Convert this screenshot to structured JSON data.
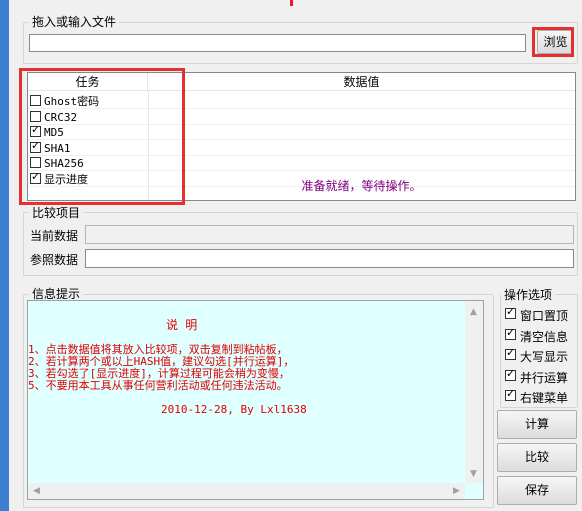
{
  "file_group": {
    "title": "拖入或输入文件",
    "input_value": "",
    "browse_label": "浏览"
  },
  "table": {
    "col_task": "任务",
    "col_value": "数据值",
    "tasks": [
      {
        "label": "Ghost密码",
        "checked": false
      },
      {
        "label": "CRC32",
        "checked": false
      },
      {
        "label": "MD5",
        "checked": true
      },
      {
        "label": "SHA1",
        "checked": true
      },
      {
        "label": "SHA256",
        "checked": false
      },
      {
        "label": "显示进度",
        "checked": true
      }
    ],
    "status": "准备就绪，等待操作。"
  },
  "compare": {
    "title": "比较项目",
    "current_label": "当前数据",
    "current_value": "",
    "reference_label": "参照数据",
    "reference_value": ""
  },
  "info": {
    "title": "信息提示",
    "heading": "说 明",
    "lines": [
      "1、点击数据值将其放入比较项，双击复制到粘帖板，",
      "2、若计算两个或以上HASH值，建议勾选[并行运算]，",
      "3、若勾选了[显示进度]，计算过程可能会稍为变慢，",
      "5、不要用本工具从事任何营利活动或任何违法活动。"
    ],
    "footer": "2010-12-28, By Lxl1638"
  },
  "options": {
    "title": "操作选项",
    "items": [
      {
        "label": "窗口置顶",
        "checked": true
      },
      {
        "label": "清空信息",
        "checked": true
      },
      {
        "label": "大写显示",
        "checked": true
      },
      {
        "label": "并行运算",
        "checked": true
      },
      {
        "label": "右键菜单",
        "checked": true
      }
    ]
  },
  "buttons": {
    "calc": "计算",
    "compare": "比较",
    "save": "保存"
  },
  "colors": {
    "highlight_red": "#e53030",
    "info_bg": "#e0ffff",
    "info_text": "#e00000",
    "status_text": "#800080"
  }
}
